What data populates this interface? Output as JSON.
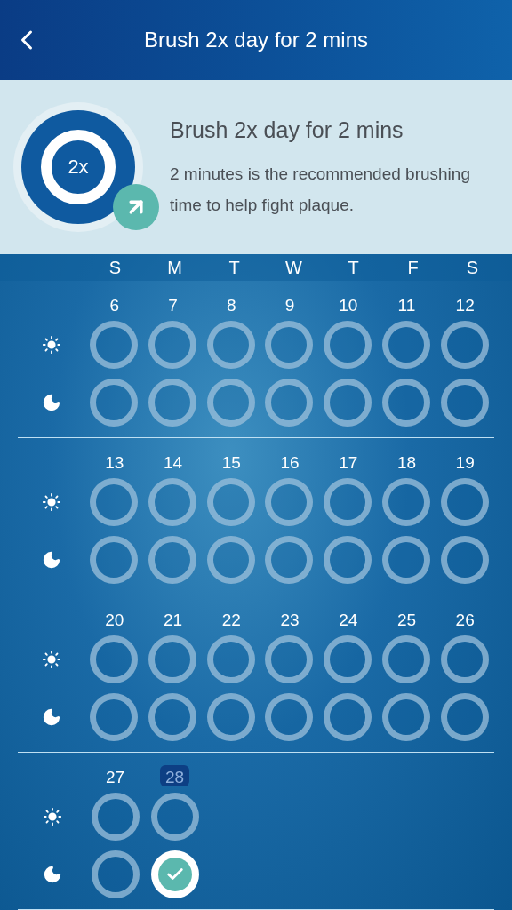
{
  "header": {
    "title": "Brush 2x day for 2 mins"
  },
  "info": {
    "badge": "2x",
    "title": "Brush 2x day for 2 mins",
    "text": "2 minutes is the recommended brushing time to help fight plaque."
  },
  "weekdays": [
    "S",
    "M",
    "T",
    "W",
    "T",
    "F",
    "S"
  ],
  "weeks": [
    {
      "days": [
        {
          "label": "6",
          "selected": false,
          "morning": false,
          "evening": false
        },
        {
          "label": "7",
          "selected": false,
          "morning": false,
          "evening": false
        },
        {
          "label": "8",
          "selected": false,
          "morning": false,
          "evening": false
        },
        {
          "label": "9",
          "selected": false,
          "morning": false,
          "evening": false
        },
        {
          "label": "10",
          "selected": false,
          "morning": false,
          "evening": false
        },
        {
          "label": "11",
          "selected": false,
          "morning": false,
          "evening": false
        },
        {
          "label": "12",
          "selected": false,
          "morning": false,
          "evening": false
        }
      ]
    },
    {
      "days": [
        {
          "label": "13",
          "selected": false,
          "morning": false,
          "evening": false
        },
        {
          "label": "14",
          "selected": false,
          "morning": false,
          "evening": false
        },
        {
          "label": "15",
          "selected": false,
          "morning": false,
          "evening": false
        },
        {
          "label": "16",
          "selected": false,
          "morning": false,
          "evening": false
        },
        {
          "label": "17",
          "selected": false,
          "morning": false,
          "evening": false
        },
        {
          "label": "18",
          "selected": false,
          "morning": false,
          "evening": false
        },
        {
          "label": "19",
          "selected": false,
          "morning": false,
          "evening": false
        }
      ]
    },
    {
      "days": [
        {
          "label": "20",
          "selected": false,
          "morning": false,
          "evening": false
        },
        {
          "label": "21",
          "selected": false,
          "morning": false,
          "evening": false
        },
        {
          "label": "22",
          "selected": false,
          "morning": false,
          "evening": false
        },
        {
          "label": "23",
          "selected": false,
          "morning": false,
          "evening": false
        },
        {
          "label": "24",
          "selected": false,
          "morning": false,
          "evening": false
        },
        {
          "label": "25",
          "selected": false,
          "morning": false,
          "evening": false
        },
        {
          "label": "26",
          "selected": false,
          "morning": false,
          "evening": false
        }
      ]
    },
    {
      "days": [
        {
          "label": "27",
          "selected": false,
          "morning": false,
          "evening": false
        },
        {
          "label": "28",
          "selected": true,
          "morning": false,
          "evening": true
        }
      ]
    }
  ]
}
